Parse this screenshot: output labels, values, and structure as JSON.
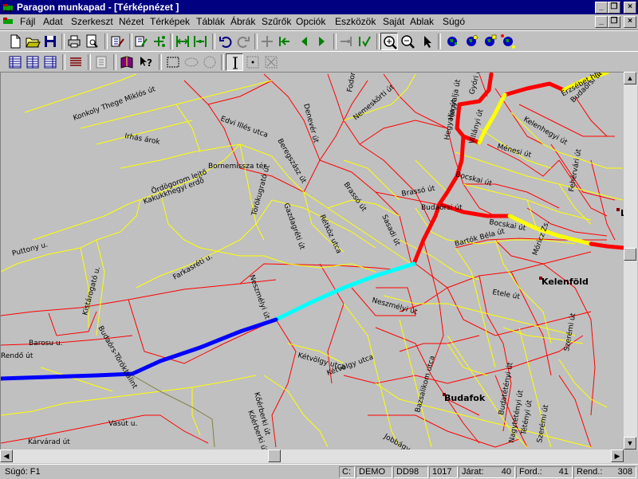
{
  "window": {
    "title": "Paragon munkapad - [Térképnézet ]"
  },
  "menu": [
    "Fájl",
    "Adat",
    "Szerkeszt",
    "Nézet",
    "Térképek",
    "Táblák",
    "Ábrák",
    "Szűrők",
    "Opciók",
    "Eszközök",
    "Saját",
    "Ablak",
    "Súgó"
  ],
  "toolbar_icons": {
    "row1": [
      "new-file-icon",
      "open-folder-icon",
      "save-icon",
      "print-icon",
      "print-preview-icon",
      "edit-links-icon",
      "edit-nodes-icon",
      "add-node-icon",
      "link-split-icon",
      "link-merge-icon",
      "undo-icon",
      "redo-icon",
      "measure-icon",
      "arrow-first-icon",
      "arrow-left-icon",
      "arrow-right-icon",
      "connect-icon",
      "check-route-icon",
      "zoom-in-icon",
      "zoom-out-icon",
      "pointer-icon",
      "globe-icon",
      "globe-icon",
      "globe-icon",
      "globe-icon"
    ],
    "row2": [
      "table-icon",
      "table-icon",
      "table-icon",
      "list-icon",
      "report-icon",
      "book-icon",
      "help-icon",
      "rect-select-icon",
      "ellipse-select-icon",
      "circle-select-icon",
      "info-icon",
      "point-icon",
      "cross-icon"
    ]
  },
  "map": {
    "street_labels": [
      {
        "t": "Konkoly Thege Miklós út"
      },
      {
        "t": "Irhás árok"
      },
      {
        "t": "Edvi Illés utca"
      },
      {
        "t": "Denevér út"
      },
      {
        "t": "Nemeskörti út"
      },
      {
        "t": "Hegyalja út"
      },
      {
        "t": "Hegyalja út"
      },
      {
        "t": "Erzsébet híd"
      },
      {
        "t": "Kelenhegyi út"
      },
      {
        "t": "Ménesi út"
      },
      {
        "t": "Bocskai út"
      },
      {
        "t": "Budaörsi út"
      },
      {
        "t": "Törökugrató út"
      },
      {
        "t": "Kakukkhegyi erdő"
      },
      {
        "t": "Ördögorom lejtő"
      },
      {
        "t": "Bornemissza tér"
      },
      {
        "t": "Brassó út"
      },
      {
        "t": "Brassó út"
      },
      {
        "t": "Gazdagréti út"
      },
      {
        "t": "Rétköz utca"
      },
      {
        "t": "Sasadi út"
      },
      {
        "t": "Beregszász út"
      },
      {
        "t": "Budaörsi út"
      },
      {
        "t": "Villányi út"
      },
      {
        "t": "Bartók Béla út"
      },
      {
        "t": "Móricz Zs."
      },
      {
        "t": "Fehérvári út"
      },
      {
        "t": "Bocskai út"
      },
      {
        "t": "Puttony u."
      },
      {
        "t": "Neszmélyi út"
      },
      {
        "t": "Farkasréti u."
      },
      {
        "t": "Kőérberki út"
      },
      {
        "t": "Kistárogató u."
      },
      {
        "t": "Budaörs-Törökbálint"
      },
      {
        "t": "Barosu u."
      },
      {
        "t": "Neszmélyi út"
      },
      {
        "t": "Kétvölgy utca"
      },
      {
        "t": "Etele út"
      },
      {
        "t": "Kétvölgy utca"
      },
      {
        "t": "Budatétényi út"
      },
      {
        "t": "Kőérberki út"
      },
      {
        "t": "Vasút u."
      },
      {
        "t": "Tétényi út"
      },
      {
        "t": "Szerémi út"
      },
      {
        "t": "Nagytétényi út"
      },
      {
        "t": "Jobbágy út"
      },
      {
        "t": "Szerémi út"
      },
      {
        "t": "Kárvárad út"
      },
      {
        "t": "Bazsalikom utca"
      },
      {
        "t": "Rendő út"
      },
      {
        "t": "Gyóri út"
      },
      {
        "t": "Fodor"
      }
    ],
    "places": [
      {
        "t": "Kelenföld"
      },
      {
        "t": "Budafok"
      },
      {
        "t": "Lá"
      }
    ],
    "colors": {
      "background": "#c0c0c0",
      "minor": "#ff0000",
      "secondary": "#ffff00",
      "route_red": "#ff0000",
      "route_yellow": "#ffff00",
      "route_cyan": "#00ffff",
      "route_blue": "#0000ff"
    }
  },
  "status": {
    "help": "Súgó: F1",
    "drive": "C:",
    "mode": "DEMO",
    "dd": "DD98",
    "num": "1017",
    "jarat_label": "Járat:",
    "jarat_value": "40",
    "ford_label": "Ford.:",
    "ford_value": "41",
    "rend_label": "Rend.:",
    "rend_value": "308"
  }
}
